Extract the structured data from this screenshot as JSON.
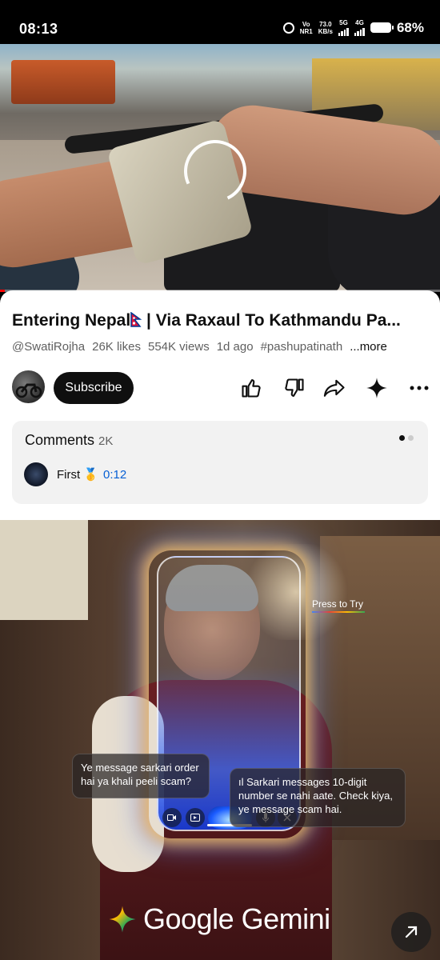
{
  "status_bar": {
    "time": "08:13",
    "net_line1": "Vo",
    "net_line2": "NR1",
    "speed_value": "73.0",
    "speed_unit": "KB/s",
    "sim1_label": "5G",
    "sim2_label": "4G",
    "battery": "68%"
  },
  "video": {
    "progress_fraction": 0.01,
    "progress_color": "#ff0000"
  },
  "details": {
    "title": "Entering Nepal",
    "title_rest": " | Via Raxaul To Kathmandu Pa...",
    "channel": "@SwatiRojha",
    "likes": "26K likes",
    "views": "554K views",
    "age": "1d ago",
    "hashtag": "#pashupatinath",
    "more": "...more",
    "subscribe": "Subscribe",
    "icons": [
      "like-icon",
      "dislike-icon",
      "share-icon",
      "sparkle-icon",
      "more-icon"
    ]
  },
  "comments": {
    "label": "Comments",
    "count": "2K",
    "first_comment": "First 🥇",
    "timestamp": "0:12"
  },
  "ad": {
    "press_to_try": "Press to Try",
    "bubble_user": "Ye message sarkari order hai ya khali peeli scam?",
    "bubble_gemini": "Sarkari messages 10-digit number se nahi aate. Check kiya, ye message scam hai.",
    "brand": "Google Gemini",
    "accent_colors": [
      "#4285f4",
      "#ea4335",
      "#fbbc05",
      "#34a853"
    ]
  }
}
